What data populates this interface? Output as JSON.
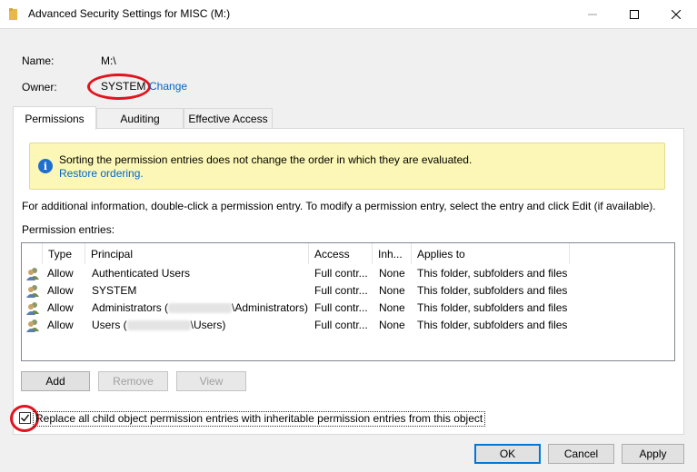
{
  "window": {
    "title": "Advanced Security Settings for MISC (M:)",
    "min_glyph": "—",
    "max_glyph": "☐",
    "close_glyph": "✕"
  },
  "header": {
    "name_label": "Name:",
    "name_value": "M:\\",
    "owner_label": "Owner:",
    "owner_value": "SYSTEM",
    "change_link": "Change"
  },
  "tabs": [
    {
      "label": "Permissions",
      "active": true
    },
    {
      "label": "Auditing",
      "active": false
    },
    {
      "label": "Effective Access",
      "active": false
    }
  ],
  "info": {
    "icon": "info-icon",
    "message": "Sorting the permission entries does not change the order in which they are evaluated.",
    "restore_link": "Restore ordering."
  },
  "help_text": "For additional information, double-click a permission entry. To modify a permission entry, select the entry and click Edit (if available).",
  "entries_label": "Permission entries:",
  "table": {
    "columns": [
      "Type",
      "Principal",
      "Access",
      "Inh...",
      "Applies to"
    ],
    "rows": [
      {
        "type": "Allow",
        "principal": "Authenticated Users",
        "principal_suffix": "",
        "access": "Full contr...",
        "inherited": "None",
        "applies_to": "This folder, subfolders and files"
      },
      {
        "type": "Allow",
        "principal": "SYSTEM",
        "principal_suffix": "",
        "access": "Full contr...",
        "inherited": "None",
        "applies_to": "This folder, subfolders and files"
      },
      {
        "type": "Allow",
        "principal": "Administrators (",
        "principal_suffix": "\\Administrators)",
        "access": "Full contr...",
        "inherited": "None",
        "applies_to": "This folder, subfolders and files"
      },
      {
        "type": "Allow",
        "principal": "Users (",
        "principal_suffix": "\\Users)",
        "access": "Full contr...",
        "inherited": "None",
        "applies_to": "This folder, subfolders and files"
      }
    ]
  },
  "buttons": {
    "add": "Add",
    "remove": "Remove",
    "view": "View",
    "ok": "OK",
    "cancel": "Cancel",
    "apply": "Apply"
  },
  "checkbox": {
    "label": "Replace all child object permission entries with inheritable permission entries from this object",
    "checked": true
  },
  "colors": {
    "link": "#0066cc",
    "annotation_red": "#e0141e",
    "info_background": "#fcf7b6",
    "accent": "#0078d7"
  }
}
